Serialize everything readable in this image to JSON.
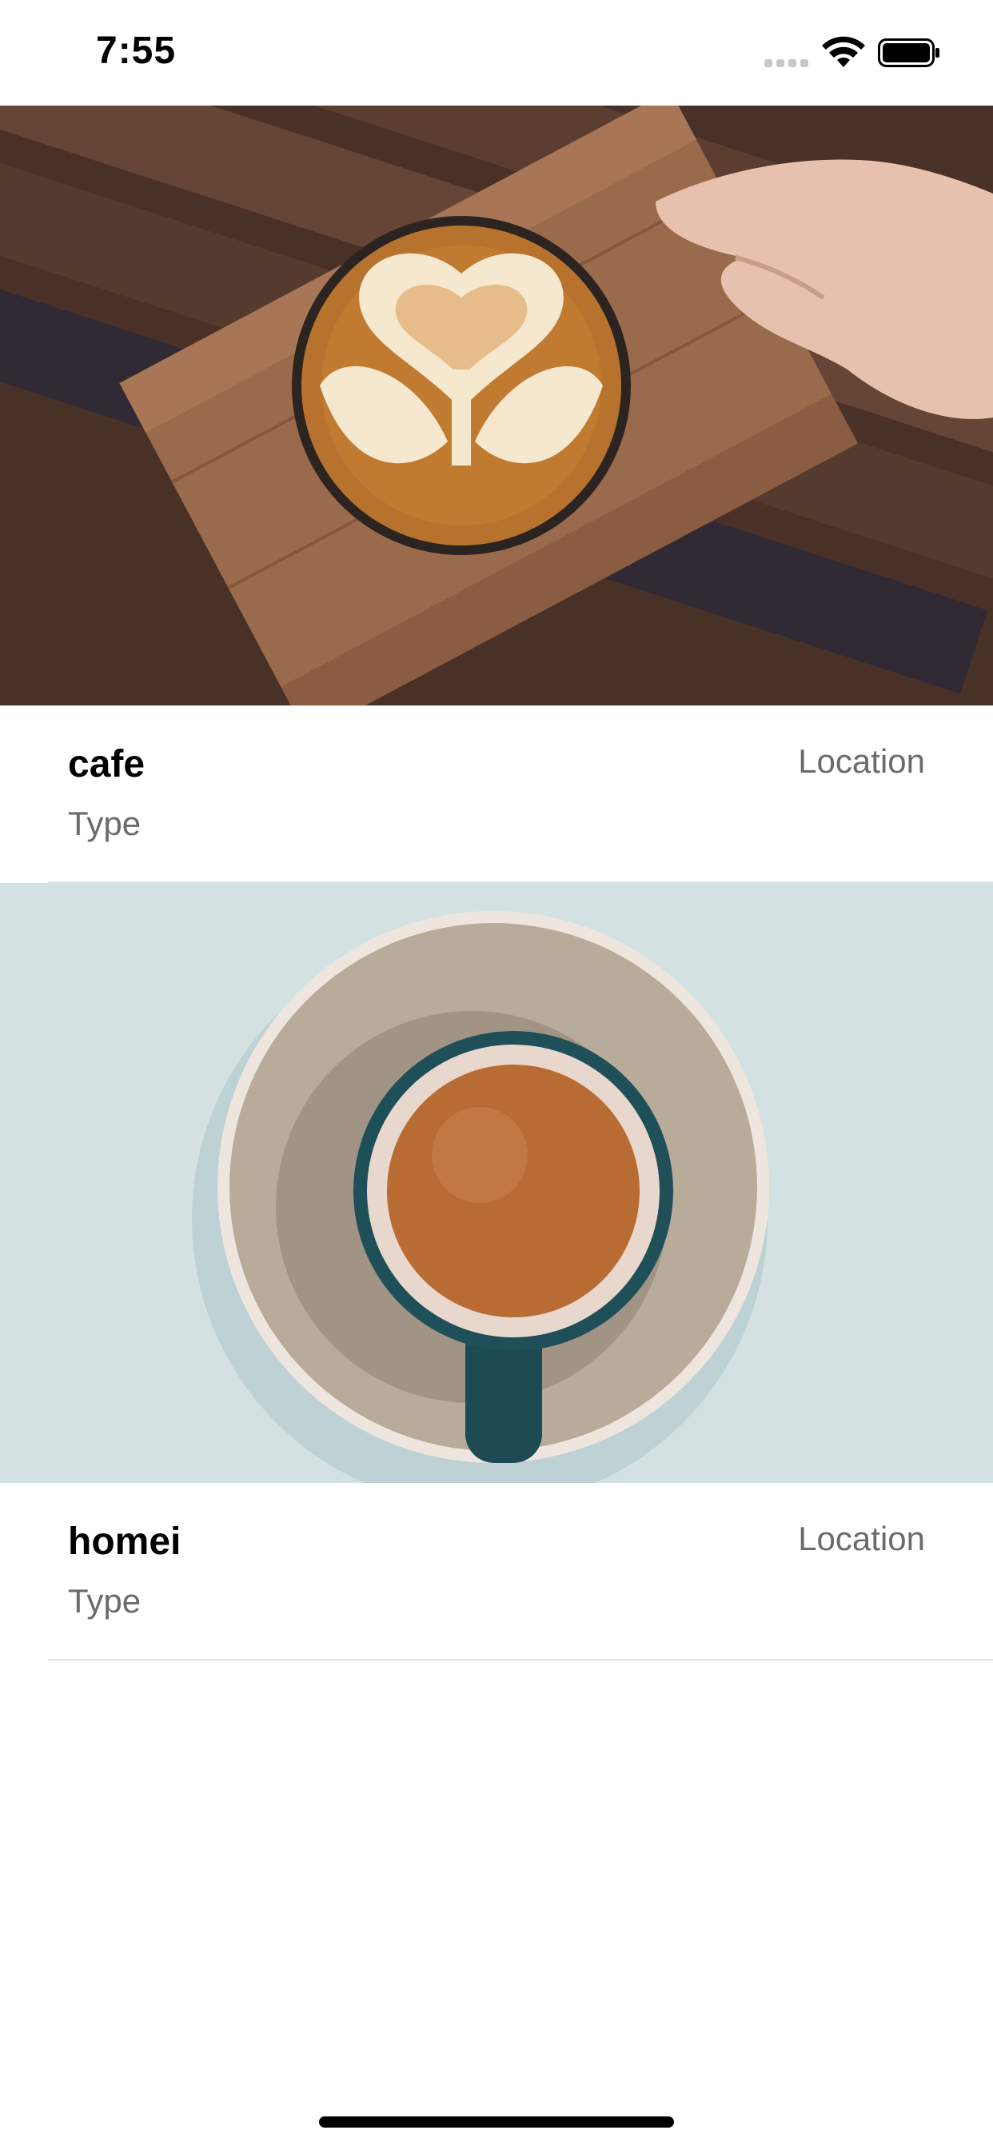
{
  "status_bar": {
    "time": "7:55",
    "icons": [
      "signal-icon",
      "wifi-icon",
      "battery-icon"
    ]
  },
  "list": {
    "items": [
      {
        "title": "cafe",
        "subtitle": "Type",
        "location": "Location",
        "image_icon": "latte-art-photo"
      },
      {
        "title": "homei",
        "subtitle": "Type",
        "location": "Location",
        "image_icon": "coffee-cup-photo"
      }
    ]
  },
  "colors": {
    "title": "#000000",
    "secondary_text": "#6b6b6e",
    "separator": "#e2e2e4",
    "background": "#ffffff"
  }
}
